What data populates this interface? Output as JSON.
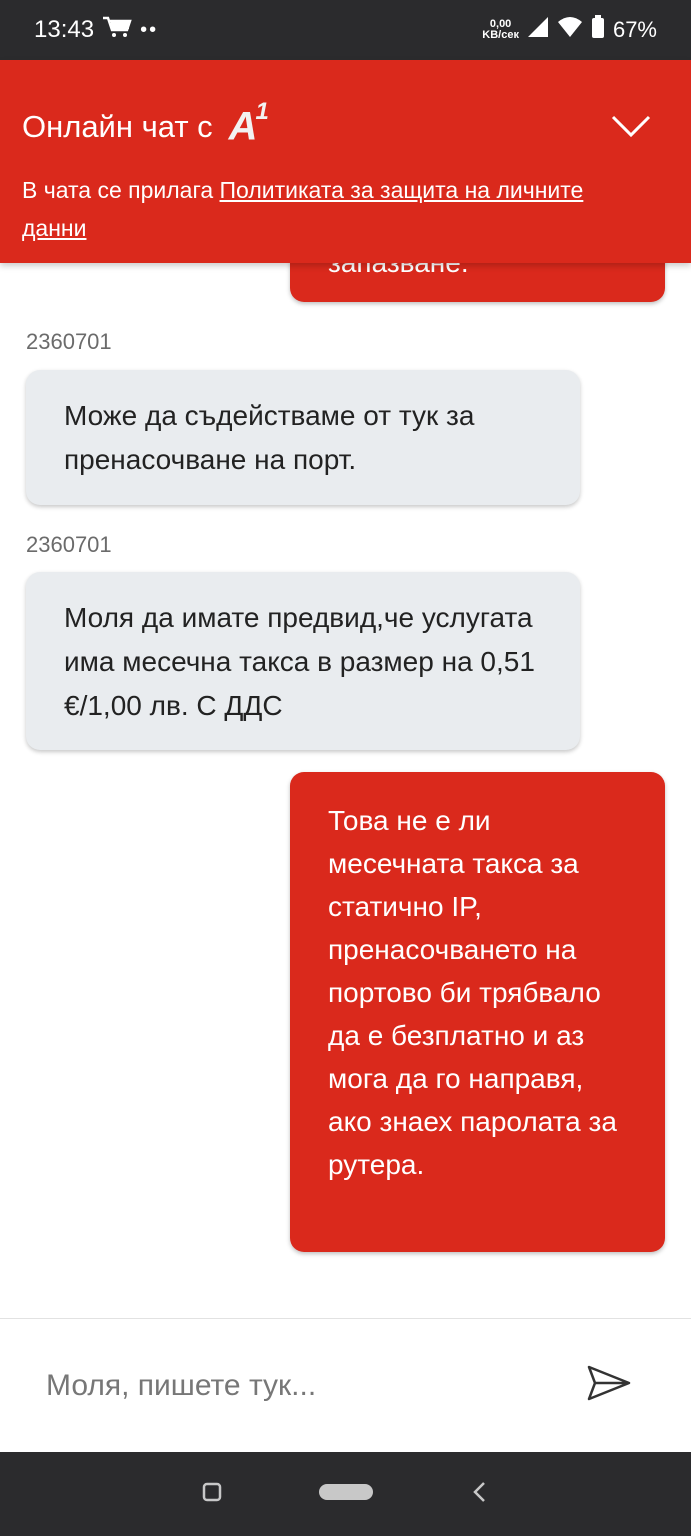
{
  "status_bar": {
    "time": "13:43",
    "notification_icons": [
      "cart-icon",
      "dots-icon"
    ],
    "speed_value": "0,00",
    "speed_unit": "KB/сек",
    "battery": "67%"
  },
  "header": {
    "title": "Онлайн чат с",
    "logo_text": "A",
    "logo_sup": "1",
    "policy_prefix": "В чата се прилага ",
    "policy_link": "Политиката за защита на личните данни",
    "collapse_icon": "chevron-down-icon"
  },
  "messages": [
    {
      "sender": "user",
      "text": "запазване."
    },
    {
      "sender": "agent",
      "agent_id": "2360701",
      "text": "Може да съдействаме от тук за пренасочване на порт."
    },
    {
      "sender": "agent",
      "agent_id": "2360701",
      "text": "Моля да имате предвид,че услугата има месечна такса в размер на 0,51 €/1,00 лв. С ДДС"
    },
    {
      "sender": "user",
      "text": "Това не е ли месечната такса за статично IP, пренасочването на портово би трябвало да е безплатно и аз мога да го направя, ако знаех паролата за рутера."
    }
  ],
  "composer": {
    "placeholder": "Моля, пишете тук...",
    "send_icon": "send-icon"
  },
  "colors": {
    "brand_red": "#da291c",
    "agent_bubble": "#e9ecef",
    "system_bar": "#2b2b2d"
  }
}
